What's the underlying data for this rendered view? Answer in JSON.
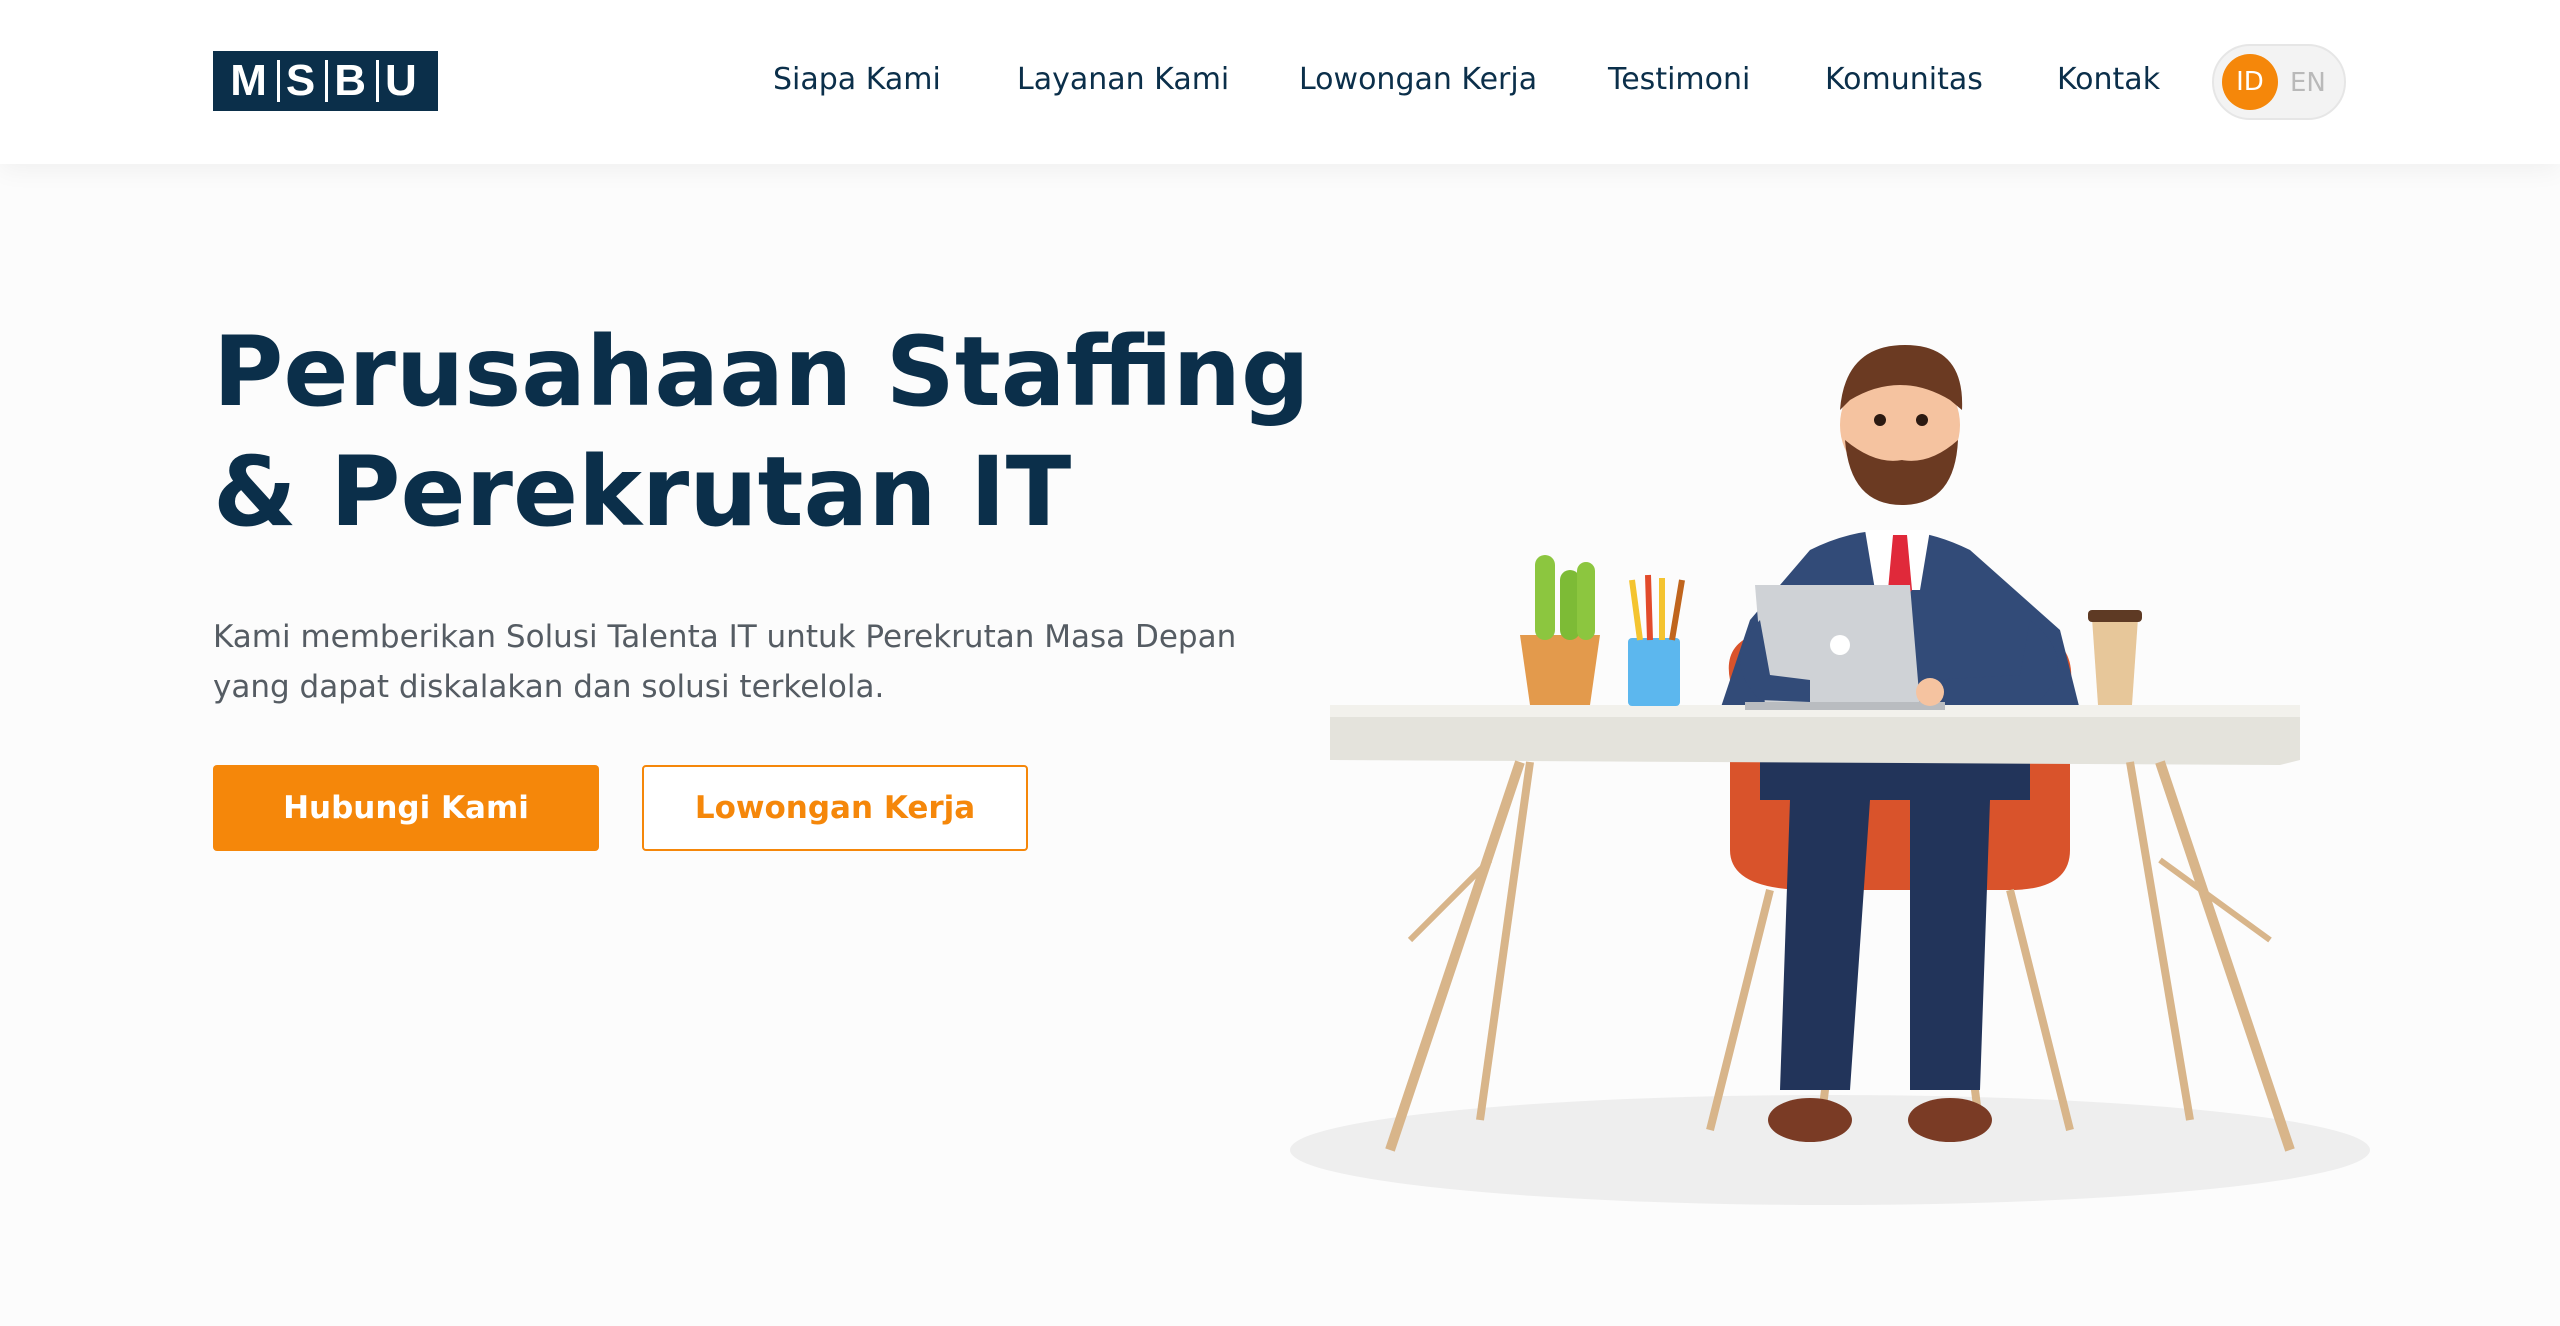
{
  "brand": {
    "logo_letters": [
      "M",
      "S",
      "B",
      "U"
    ],
    "logo_color": "#0b2f4a"
  },
  "nav": {
    "items": [
      {
        "label": "Siapa Kami"
      },
      {
        "label": "Layanan Kami"
      },
      {
        "label": "Lowongan Kerja"
      },
      {
        "label": "Testimoni"
      },
      {
        "label": "Komunitas"
      },
      {
        "label": "Kontak"
      }
    ]
  },
  "language": {
    "active": "ID",
    "inactive": "EN"
  },
  "hero": {
    "title_lines": [
      "Perusahaan Staffing",
      "& Perekrutan IT"
    ],
    "description_lines": [
      "Kami memberikan Solusi Talenta IT untuk Perekrutan Masa Depan",
      "yang dapat diskalakan dan solusi terkelola."
    ],
    "primary_button": "Hubungi Kami",
    "secondary_button": "Lowongan Kerja"
  },
  "colors": {
    "accent": "#f5870a",
    "navy": "#0b2f4a",
    "body_text": "#555c63"
  },
  "illustration": {
    "icon": "businessman-at-desk-illustration"
  }
}
